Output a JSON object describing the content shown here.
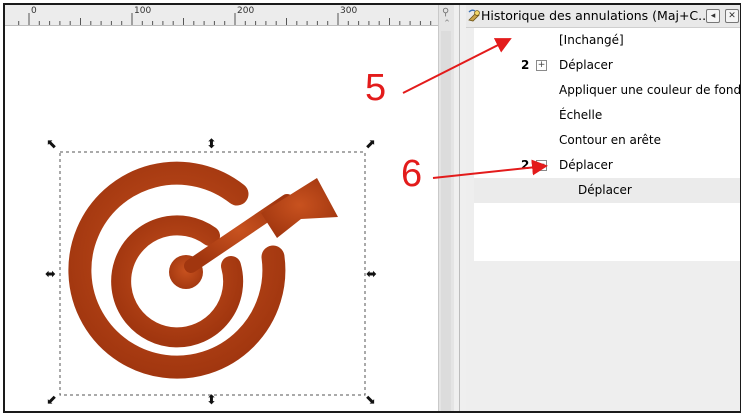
{
  "ruler": {
    "labels": [
      "0",
      "100",
      "200",
      "300"
    ]
  },
  "canvas": {
    "selection_handles": [
      "handle-nw",
      "handle-n",
      "handle-ne",
      "handle-w",
      "handle-e",
      "handle-sw",
      "handle-s",
      "handle-se"
    ],
    "object": "target-arrow-icon",
    "object_color": "#b5401a"
  },
  "panel": {
    "title": "Historique des annulations (Maj+C...",
    "icon": "undo-history-icon",
    "buttons": [
      "collapse-icon",
      "close-icon"
    ],
    "items": [
      {
        "count": "",
        "expander": "",
        "label": "[Inchangé]"
      },
      {
        "count": "2",
        "expander": "⊞",
        "label": "Déplacer"
      },
      {
        "count": "",
        "expander": "",
        "label": "Appliquer une couleur de fond"
      },
      {
        "count": "",
        "expander": "",
        "label": "Échelle"
      },
      {
        "count": "",
        "expander": "",
        "label": "Contour en arête"
      },
      {
        "count": "2",
        "expander": "⊟",
        "label": "Déplacer"
      },
      {
        "count": "",
        "expander": "",
        "label": "Déplacer"
      }
    ]
  },
  "annotations": {
    "label_5": "5",
    "label_6": "6",
    "color": "#e31b1b"
  }
}
